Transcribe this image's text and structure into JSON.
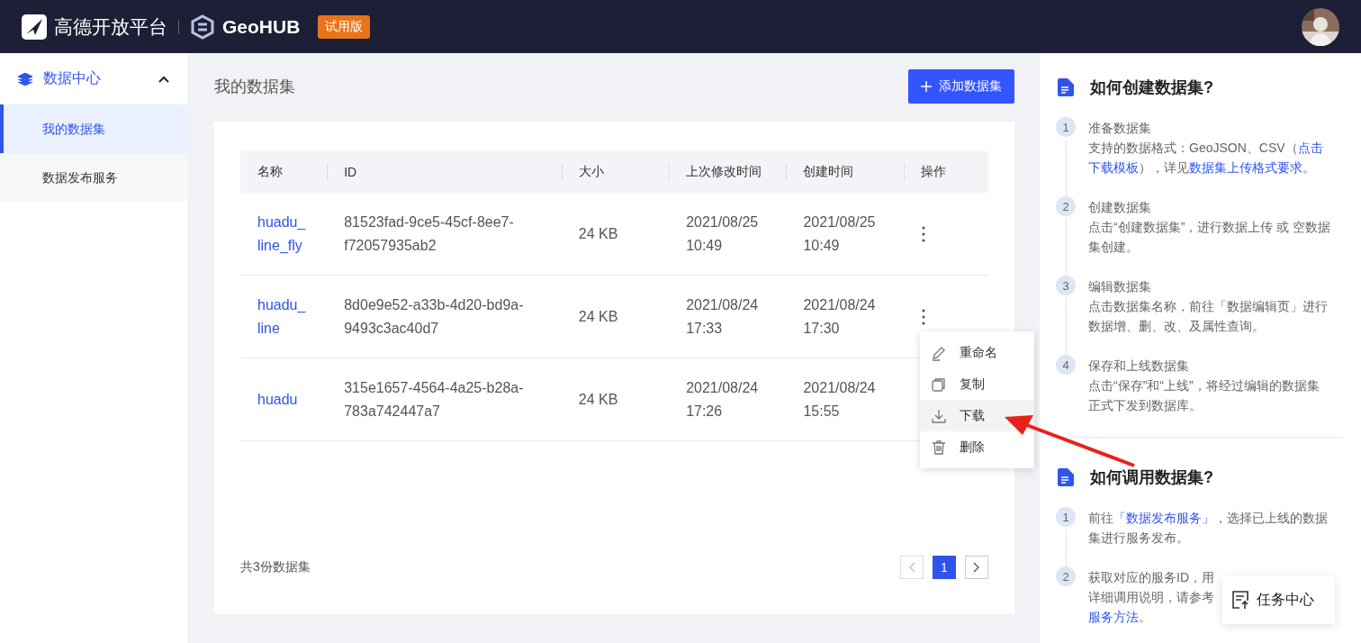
{
  "header": {
    "brand": "高德开放平台",
    "product": "GeoHUB",
    "badge": "试用版"
  },
  "sidebar": {
    "group": {
      "label": "数据中心",
      "expanded": true,
      "children": [
        {
          "label": "我的数据集",
          "selected": true
        },
        {
          "label": "数据发布服务",
          "selected": false
        }
      ]
    }
  },
  "page_title": "我的数据集",
  "add_button": "添加数据集",
  "table": {
    "columns": [
      "名称",
      "ID",
      "大小",
      "上次修改时间",
      "创建时间",
      "操作"
    ],
    "rows": [
      {
        "name": "huadu_line_fly",
        "id": "81523fad-9ce5-45cf-8ee7-f72057935ab2",
        "size": "24 KB",
        "modified": "2021/08/25 10:49",
        "created": "2021/08/25 10:49"
      },
      {
        "name": "huadu_line",
        "id": "8d0e9e52-a33b-4d20-bd9a-9493c3ac40d7",
        "size": "24 KB",
        "modified": "2021/08/24 17:33",
        "created": "2021/08/24 17:30"
      },
      {
        "name": "huadu",
        "id": "315e1657-4564-4a25-b28a-783a742447a7",
        "size": "24 KB",
        "modified": "2021/08/24 17:26",
        "created": "2021/08/24 15:55"
      }
    ]
  },
  "total": "共3份数据集",
  "pagination": {
    "prev_disabled": true,
    "pages": [
      {
        "label": "1",
        "selected": true
      }
    ],
    "next_disabled": false
  },
  "context_menu": [
    {
      "kind": "rename",
      "label": "重命名",
      "highlighted": false
    },
    {
      "kind": "copy",
      "label": "复制",
      "highlighted": false
    },
    {
      "kind": "download",
      "label": "下载",
      "highlighted": true
    },
    {
      "kind": "delete",
      "label": "删除",
      "highlighted": false
    }
  ],
  "help": [
    {
      "title": "如何创建数据集?",
      "steps": [
        {
          "number": "1",
          "title": "准备数据集",
          "lines": [
            [
              {
                "kind": "text",
                "text": "支持的数据格式：GeoJSON、CSV（"
              },
              {
                "kind": "link",
                "text": "点击"
              }
            ],
            [
              {
                "kind": "link",
                "text": "下载模板"
              },
              {
                "kind": "text",
                "text": "），详见"
              },
              {
                "kind": "link",
                "text": "数据集上传格式要求"
              },
              {
                "kind": "text",
                "text": "。"
              }
            ]
          ]
        },
        {
          "number": "2",
          "title": "创建数据集",
          "lines": [
            [
              {
                "kind": "text",
                "text": "点击“创建数据集”，进行数据上传 或 空数据"
              }
            ],
            [
              {
                "kind": "text",
                "text": "集创建。"
              }
            ]
          ]
        },
        {
          "number": "3",
          "title": "编辑数据集",
          "lines": [
            [
              {
                "kind": "text",
                "text": "点击数据集名称，前往「数据编辑页」进行"
              }
            ],
            [
              {
                "kind": "text",
                "text": "数据增、删、改、及属性查询。"
              }
            ]
          ]
        },
        {
          "number": "4",
          "title": "保存和上线数据集",
          "lines": [
            [
              {
                "kind": "text",
                "text": "点击“保存”和“上线”，将经过编辑的数据集"
              }
            ],
            [
              {
                "kind": "text",
                "text": "正式下发到数据库。"
              }
            ]
          ]
        }
      ]
    },
    {
      "title": "如何调用数据集?",
      "steps": [
        {
          "number": "1",
          "lines": [
            [
              {
                "kind": "text",
                "text": "前往"
              },
              {
                "kind": "link",
                "text": "「数据发布服务」"
              },
              {
                "kind": "text",
                "text": "，选择已上线的数据"
              }
            ],
            [
              {
                "kind": "text",
                "text": "集进行服务发布。"
              }
            ]
          ]
        },
        {
          "number": "2",
          "lines": [
            [
              {
                "kind": "text",
                "text": "获取对应的服务ID，用"
              }
            ],
            [
              {
                "kind": "text",
                "text": "详细调用说明，请参考"
              }
            ],
            [
              {
                "kind": "link",
                "text": "服务方法"
              },
              {
                "kind": "text",
                "text": "。"
              }
            ]
          ]
        }
      ]
    }
  ],
  "task_button": "任务中心"
}
